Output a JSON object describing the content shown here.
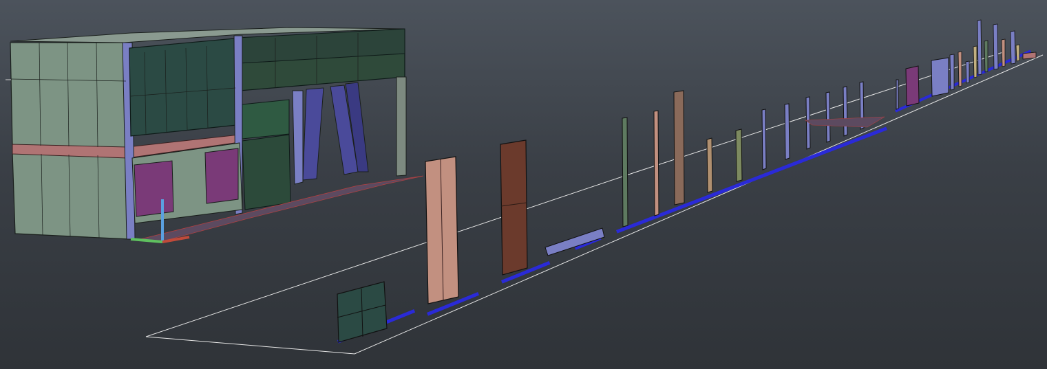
{
  "viewport": {
    "background_top": "#4c535c",
    "background_bottom": "#2f3338",
    "grid_line_color": "#e8e8e8",
    "label_color": "#2a2ad8"
  },
  "model": {
    "wall_color": "#7d9484",
    "glass_color": "#2b4a44",
    "column_color": "#7a7fc4",
    "slab_color": "#b07474",
    "door_color": "#7a3a78",
    "floor_color": "#5c4a60",
    "panel_brown": "#6b3a2c",
    "panel_tan": "#c29080"
  },
  "gizmo": {
    "x_color": "#c04a3a",
    "y_color": "#5fc05f",
    "z_color": "#5aa0e0"
  }
}
